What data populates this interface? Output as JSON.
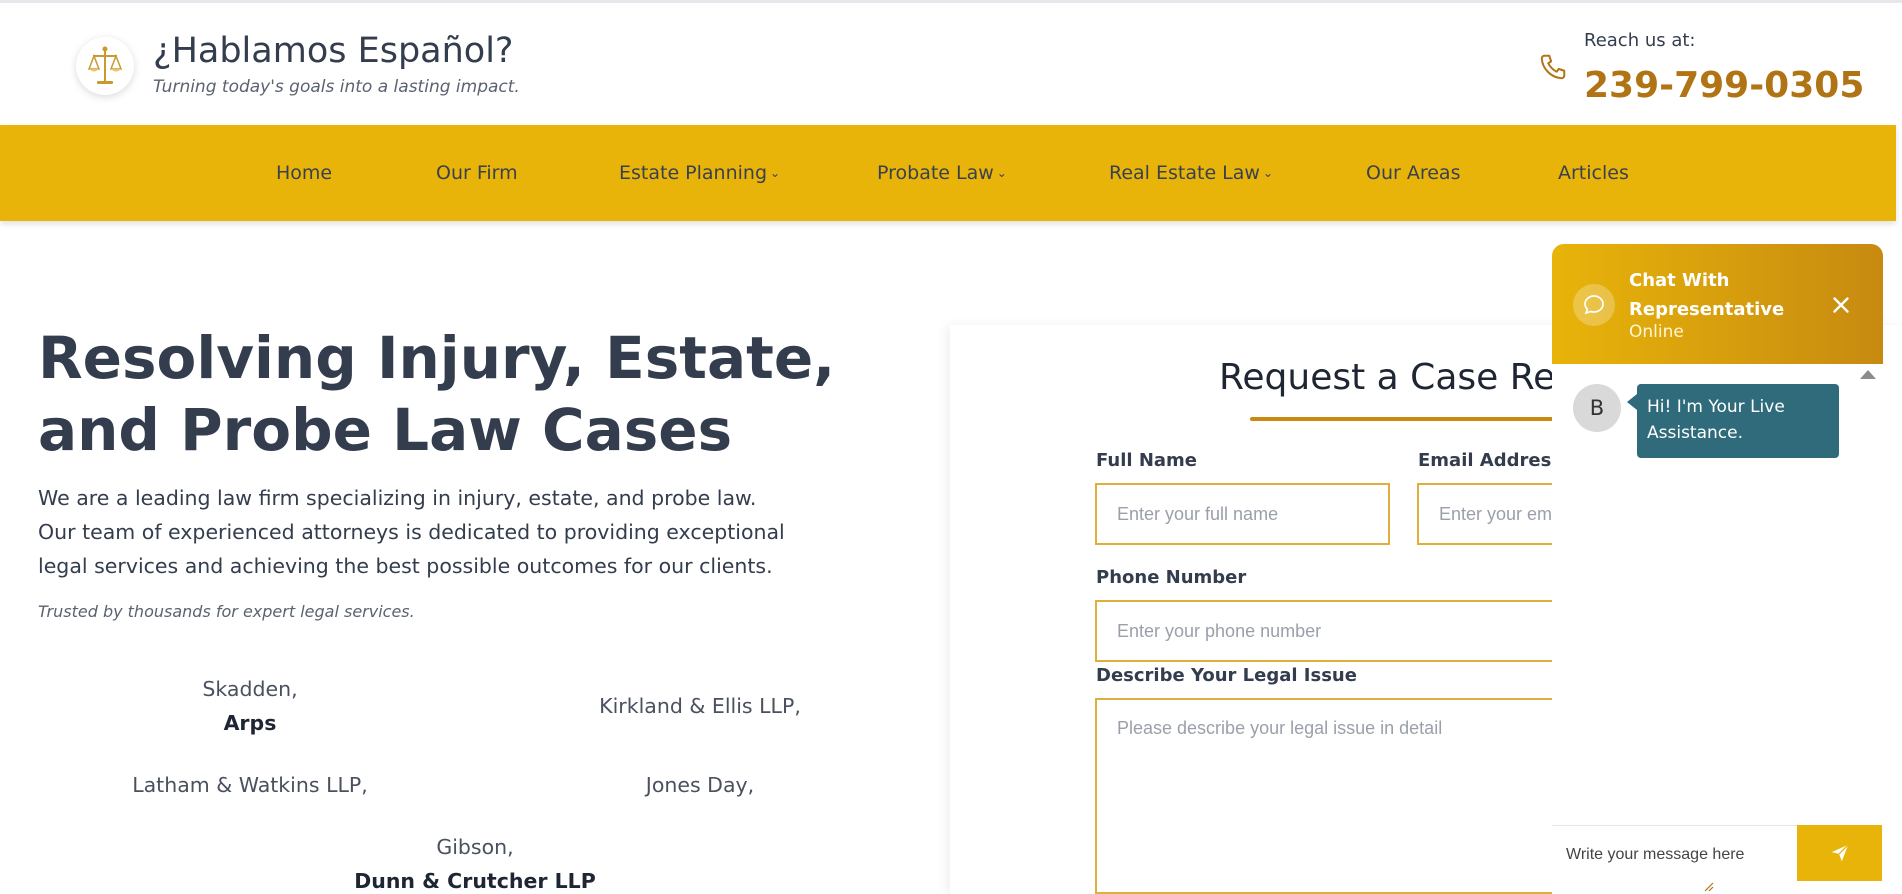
{
  "header": {
    "brand_title": "¿Hablamos Español?",
    "brand_tagline": "Turning today's goals into a lasting impact.",
    "reach_label": "Reach us at:",
    "phone": "239-799-0305",
    "logo_icon": "scales-of-justice-icon",
    "phone_icon": "phone-icon"
  },
  "nav": {
    "items": [
      {
        "label": "Home",
        "has_dropdown": false
      },
      {
        "label": "Our Firm",
        "has_dropdown": false
      },
      {
        "label": "Estate Planning",
        "has_dropdown": true
      },
      {
        "label": "Probate Law",
        "has_dropdown": true
      },
      {
        "label": "Real Estate Law",
        "has_dropdown": true
      },
      {
        "label": "Our Areas",
        "has_dropdown": false
      },
      {
        "label": "Articles",
        "has_dropdown": false
      }
    ]
  },
  "hero": {
    "title": "Resolving Injury, Estate, and Probe Law Cases",
    "text_lines": [
      "We are a leading law firm specializing in injury, estate, and probe law.",
      "Our team of experienced attorneys is dedicated to providing exceptional",
      "legal services and achieving the best possible outcomes for our clients."
    ],
    "trusted": "Trusted by thousands for expert legal services.",
    "firms": [
      {
        "line1": "Skadden,",
        "line2": "Arps"
      },
      {
        "line1": "Kirkland & Ellis LLP,",
        "line2": ""
      },
      {
        "line1": "Latham & Watkins LLP,",
        "line2": ""
      },
      {
        "line1": "Jones Day,",
        "line2": ""
      },
      {
        "line1": "Gibson,",
        "line2": "Dunn & Crutcher LLP"
      }
    ]
  },
  "form": {
    "title": "Request a Case Review",
    "full_name_label": "Full Name",
    "full_name_placeholder": "Enter your full name",
    "email_label": "Email Address",
    "email_placeholder": "Enter your email",
    "phone_label": "Phone Number",
    "phone_placeholder": "Enter your phone number",
    "issue_label": "Describe Your Legal Issue",
    "issue_placeholder": "Please describe your legal issue in detail"
  },
  "chat": {
    "title": "Chat With Representative",
    "status": "Online",
    "bot_initial": "B",
    "bot_message": "Hi! I'm Your Live Assistance.",
    "input_placeholder": "Write your message here",
    "send_icon": "paper-plane-icon",
    "close_icon": "close-icon",
    "chat_icon": "chat-bubble-icon"
  },
  "colors": {
    "accent": "#e8b40a",
    "accent_dark": "#c78a10",
    "phone_text": "#b07414",
    "text_dark": "#333d4d",
    "bot_bubble": "#2f6b7a"
  }
}
